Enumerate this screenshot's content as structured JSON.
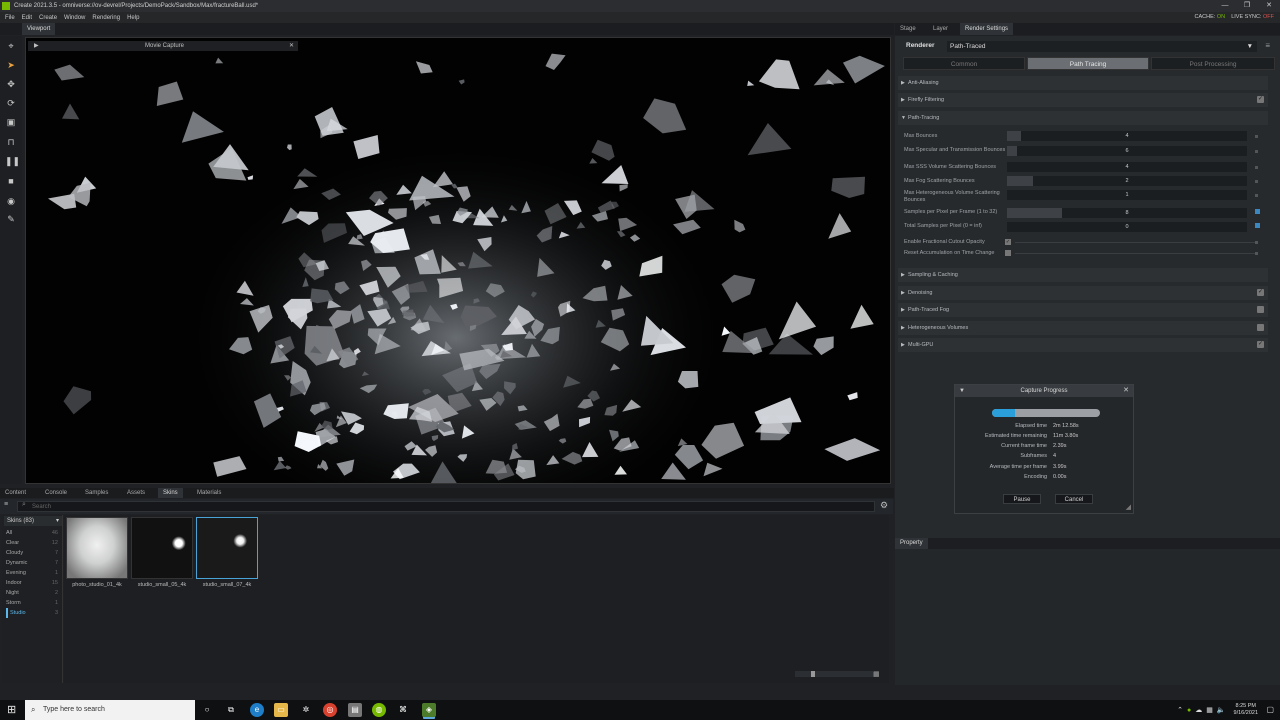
{
  "window": {
    "title": "Create 2021.3.5 - omniverse://ov-devrel/Projects/DemoPack/Sandbox/Max/fractureBall.usd*",
    "min": "—",
    "max": "❐",
    "close": "✕"
  },
  "menu": {
    "items": [
      "File",
      "Edit",
      "Create",
      "Window",
      "Rendering",
      "Help"
    ]
  },
  "status": {
    "cache_label": "CACHE:",
    "cache_value": "ON",
    "live_label": "LIVE SYNC:",
    "live_value": "OFF"
  },
  "viewport": {
    "tab": "Viewport"
  },
  "movie_capture": {
    "title": "Movie Capture",
    "play": "▶",
    "close": "✕"
  },
  "bottom_tabs": [
    "Content",
    "Console",
    "Samples",
    "Assets",
    "Skins",
    "Materials"
  ],
  "search": {
    "placeholder": "Search"
  },
  "skins": {
    "dropdown": "Skins (83)",
    "categories": [
      {
        "label": "All",
        "count": "46"
      },
      {
        "label": "Clear",
        "count": "12"
      },
      {
        "label": "Cloudy",
        "count": "7"
      },
      {
        "label": "Dynamic",
        "count": "7"
      },
      {
        "label": "Evening",
        "count": "1"
      },
      {
        "label": "Indoor",
        "count": "15"
      },
      {
        "label": "Night",
        "count": "2"
      },
      {
        "label": "Storm",
        "count": "1"
      },
      {
        "label": "Studio",
        "count": "3"
      }
    ],
    "thumbnails": [
      "photo_studio_01_4k",
      "studio_small_05_4k",
      "studio_small_07_4k"
    ]
  },
  "right_tabs": [
    "Stage",
    "Layer",
    "Render Settings"
  ],
  "render_settings": {
    "renderer_label": "Renderer",
    "renderer_value": "Path-Traced",
    "subtabs": [
      "Common",
      "Path Tracing",
      "Post Processing"
    ],
    "sections_top": [
      "Anti-Aliasing",
      "Firefly Filtering",
      "Path-Tracing"
    ],
    "props": [
      {
        "label": "Max Bounces",
        "value": "4",
        "fill": 0.06
      },
      {
        "label": "Max Specular and Transmission Bounces",
        "value": "6",
        "fill": 0.04
      },
      {
        "label": "Max SSS Volume Scattering Bounces",
        "value": "4",
        "fill": 0.0
      },
      {
        "label": "Max Fog Scattering Bounces",
        "value": "2",
        "fill": 0.11
      },
      {
        "label": "Max Heterogeneous Volume Scattering Bounces",
        "value": "1",
        "fill": 0.0
      },
      {
        "label": "Samples per Pixel per Frame (1 to 32)",
        "value": "8",
        "fill": 0.23
      },
      {
        "label": "Total Samples per Pixel (0 = inf)",
        "value": "0",
        "fill": 0.0
      }
    ],
    "bools": [
      "Enable Fractional Cutout Opacity",
      "Reset Accumulation on Time Change"
    ],
    "sections_bottom": [
      "Sampling & Caching",
      "Denoising",
      "Path-Traced Fog",
      "Heterogeneous Volumes",
      "Multi-GPU"
    ]
  },
  "capture_progress": {
    "title": "Capture Progress",
    "progress": 0.21,
    "stats": [
      {
        "k": "Elapsed time",
        "v": "2m 12.58s"
      },
      {
        "k": "Estimated time remaining",
        "v": "11m 3.80s"
      },
      {
        "k": "Current frame time",
        "v": "2.39s"
      },
      {
        "k": "Subframes",
        "v": "4"
      },
      {
        "k": "Average time per frame",
        "v": "3.99s"
      },
      {
        "k": "Encoding",
        "v": "0.00s"
      }
    ],
    "pause": "Pause",
    "cancel": "Cancel"
  },
  "property_tab": "Property",
  "taskbar": {
    "search_placeholder": "Type here to search",
    "time": "8:25 PM",
    "date": "9/16/2021"
  }
}
